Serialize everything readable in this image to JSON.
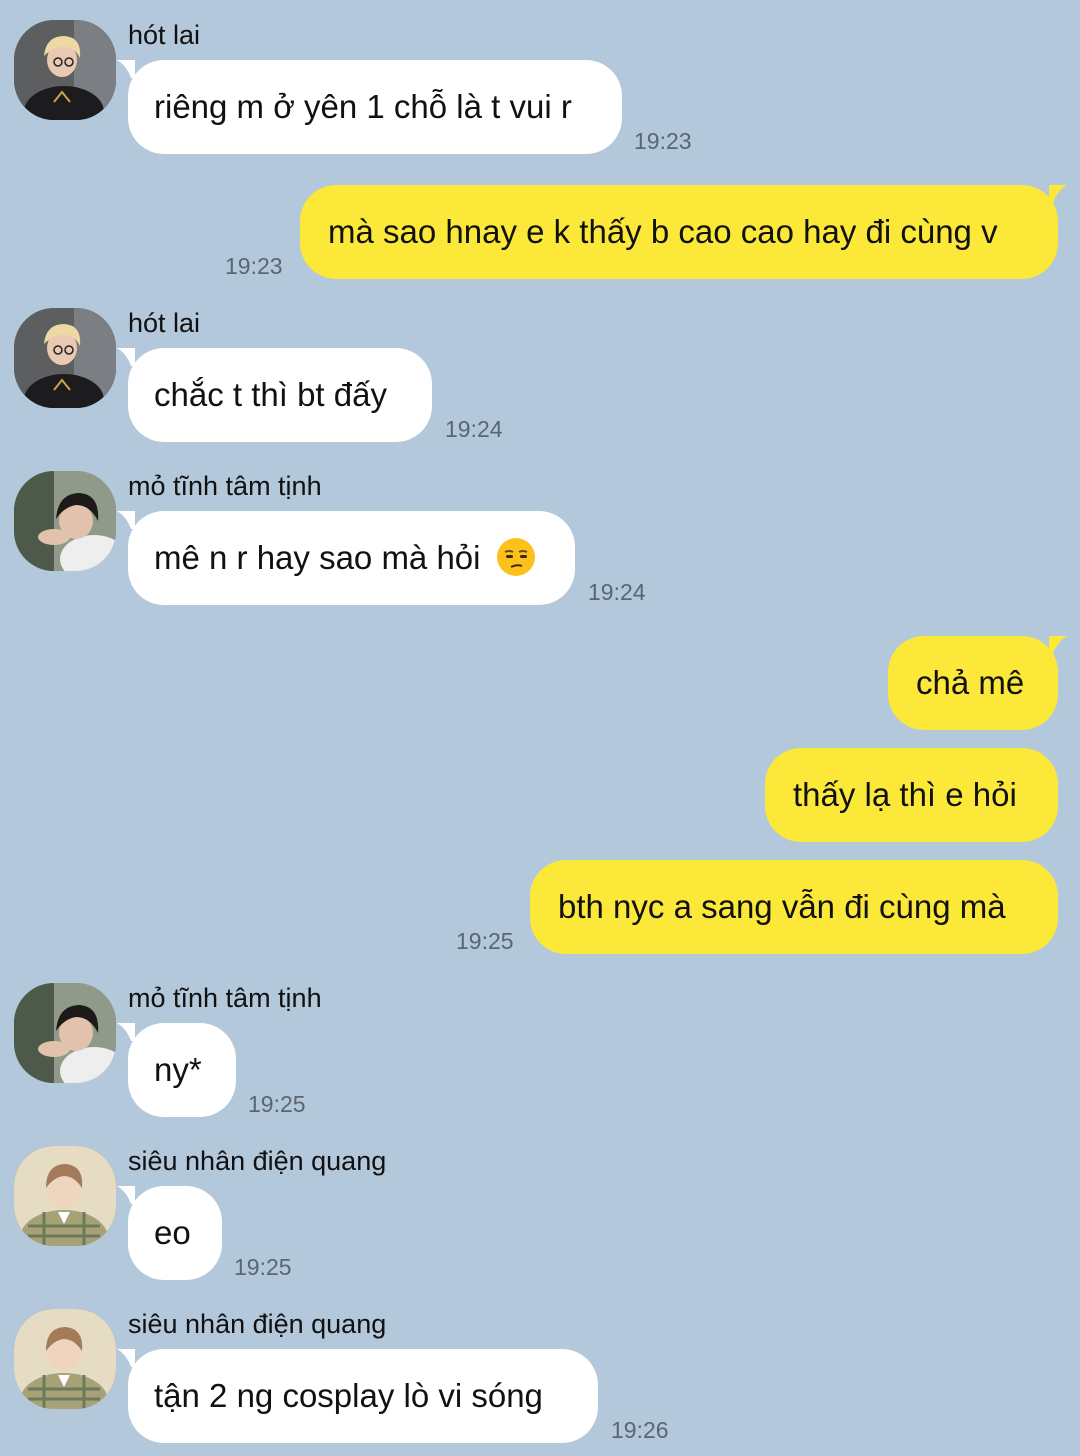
{
  "theme": {
    "background": "#b3c8db",
    "incoming_bubble": "#ffffff",
    "outgoing_bubble": "#fbe839"
  },
  "messages": [
    {
      "id": "m1",
      "direction": "incoming",
      "sender": "hót lai",
      "avatar": "avatar-blond-hair-icon",
      "text": "riêng m ở yên 1 chỗ là t vui r",
      "time": "19:23"
    },
    {
      "id": "m2",
      "direction": "outgoing",
      "text": "mà sao hnay e k thấy b cao cao hay đi cùng v",
      "time": "19:23"
    },
    {
      "id": "m3",
      "direction": "incoming",
      "sender": "hót lai",
      "avatar": "avatar-blond-hair-icon",
      "text": "chắc t thì bt đấy",
      "time": "19:24"
    },
    {
      "id": "m4",
      "direction": "incoming",
      "sender": "mỏ tĩnh tâm tịnh",
      "avatar": "avatar-dark-hair-icon",
      "text": "mê n r hay sao mà hỏi",
      "emoji": "unamused-face-icon",
      "time": "19:24"
    },
    {
      "id": "m5",
      "direction": "outgoing",
      "text": "chả mê"
    },
    {
      "id": "m6",
      "direction": "outgoing",
      "text": "thấy lạ thì e hỏi"
    },
    {
      "id": "m7",
      "direction": "outgoing",
      "text": "bth nyc a sang vẫn đi cùng mà",
      "time": "19:25"
    },
    {
      "id": "m8",
      "direction": "incoming",
      "sender": "mỏ tĩnh tâm tịnh",
      "avatar": "avatar-dark-hair-icon",
      "text": "ny*",
      "time": "19:25"
    },
    {
      "id": "m9",
      "direction": "incoming",
      "sender": "siêu nhân điện quang",
      "avatar": "avatar-plaid-shirt-icon",
      "text": "eo",
      "time": "19:25"
    },
    {
      "id": "m10",
      "direction": "incoming",
      "sender": "siêu nhân điện quang",
      "avatar": "avatar-plaid-shirt-icon",
      "text": "tận 2 ng cosplay lò vi sóng",
      "time": "19:26"
    }
  ]
}
